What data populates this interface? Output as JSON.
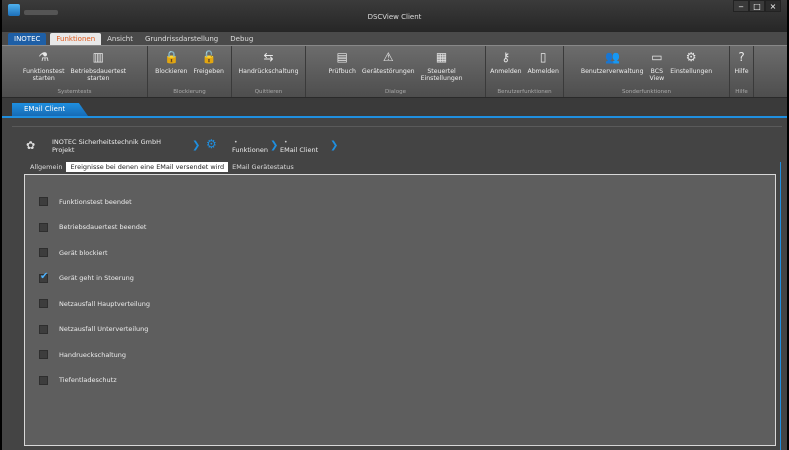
{
  "window": {
    "title": "DSCView Client",
    "min_symbol": "‒",
    "max_symbol": "□",
    "close_symbol": "×"
  },
  "ribbon_tabs": [
    "INOTEC",
    "Funktionen",
    "Ansicht",
    "Grundrissdarstellung",
    "Debug"
  ],
  "ribbon_groups": [
    {
      "label": "Systemtests",
      "buttons": [
        {
          "label": "Funktionstest\nstarten",
          "icon": "flask-icon",
          "glyph": "⚗"
        },
        {
          "label": "Betriebsdauertest\nstarten",
          "icon": "building-icon",
          "glyph": "▥"
        }
      ]
    },
    {
      "label": "Blockierung",
      "buttons": [
        {
          "label": "Blockieren",
          "icon": "lock-icon",
          "glyph": "🔒"
        },
        {
          "label": "Freigeben",
          "icon": "unlock-icon",
          "glyph": "🔓"
        }
      ]
    },
    {
      "label": "Quittieren",
      "buttons": [
        {
          "label": "Handrückschaltung",
          "icon": "hand-switch-icon",
          "glyph": "⇆"
        }
      ]
    },
    {
      "label": "Dialoge",
      "buttons": [
        {
          "label": "Prüfbuch",
          "icon": "logbook-icon",
          "glyph": "▤"
        },
        {
          "label": "Gerätestörungen",
          "icon": "device-fault-icon",
          "glyph": "⚠"
        },
        {
          "label": "Steuertel\nEinstellungen",
          "icon": "control-settings-icon",
          "glyph": "▦"
        }
      ]
    },
    {
      "label": "Benutzerfunktionen",
      "buttons": [
        {
          "label": "Anmelden",
          "icon": "key-icon",
          "glyph": "⚷"
        },
        {
          "label": "Abmelden",
          "icon": "door-icon",
          "glyph": "▯"
        }
      ]
    },
    {
      "label": "Sonderfunktionen",
      "buttons": [
        {
          "label": "Benutzerverwaltung",
          "icon": "users-icon",
          "glyph": "👥"
        },
        {
          "label": "BCS\nView",
          "icon": "monitor-icon",
          "glyph": "▭"
        },
        {
          "label": "Einstellungen",
          "icon": "settings-icon",
          "glyph": "⚙"
        }
      ]
    },
    {
      "label": "Hilfe",
      "buttons": [
        {
          "label": "Hilfe",
          "icon": "help-icon",
          "glyph": "?"
        }
      ]
    }
  ],
  "document_tab": "EMail Client",
  "breadcrumb": {
    "company": "INOTEC Sicherheitstechnik GmbH",
    "project": "Projekt",
    "section": "Funktionen",
    "page": "EMail Client",
    "dot": "•"
  },
  "inner_tabs": [
    {
      "label": "Allgemein",
      "active": false
    },
    {
      "label": "Ereignisse bei denen eine EMail versendet wird",
      "active": true
    },
    {
      "label": "EMail Gerätestatus",
      "active": false
    }
  ],
  "events": [
    {
      "label": "Funktionstest beendet",
      "checked": false
    },
    {
      "label": "Betriebsdauertest beendet",
      "checked": false
    },
    {
      "label": "Gerät blockiert",
      "checked": false
    },
    {
      "label": "Gerät geht in Stoerung",
      "checked": true
    },
    {
      "label": "Netzausfall Hauptverteilung",
      "checked": false
    },
    {
      "label": "Netzausfall Unterverteilung",
      "checked": false
    },
    {
      "label": "Handrueckschaltung",
      "checked": false
    },
    {
      "label": "Tiefentladeschutz",
      "checked": false
    }
  ],
  "colors": {
    "accent": "#1f8fe0",
    "active_tab_text": "#e05a1c",
    "brand": "#1e5fa6"
  }
}
